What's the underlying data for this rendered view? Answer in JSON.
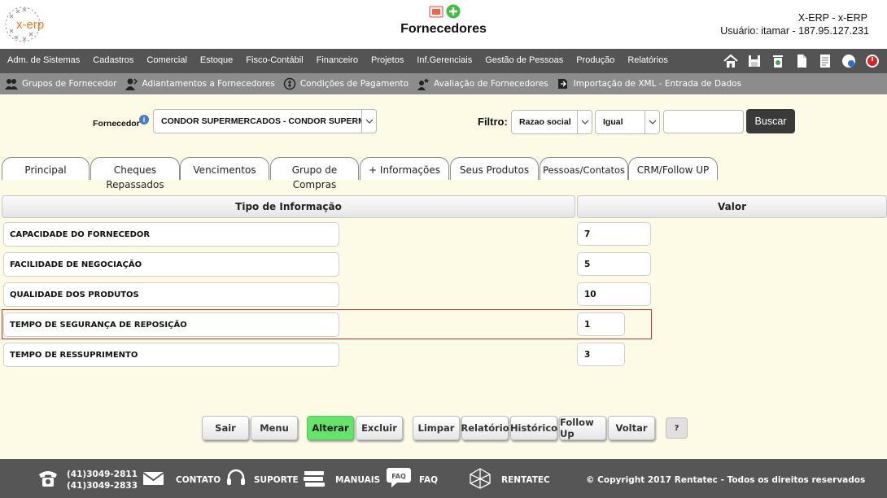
{
  "header": {
    "logo_text": "x-erp",
    "title": "Fornecedores",
    "user_line1": "X-ERP - x-ERP",
    "user_line2": "Usuário: itamar - 187.95.127.231"
  },
  "main_menu": [
    "Adm. de Sistemas",
    "Cadastros",
    "Comercial",
    "Estoque",
    "Fisco-Contábil",
    "Financeiro",
    "Projetos",
    "Inf.Gerenciais",
    "Gestão de Pessoas",
    "Produção",
    "Relatórios"
  ],
  "sub_menu": [
    {
      "label": "Grupos de Fornecedor",
      "icon": "group-icon"
    },
    {
      "label": "Adiantamentos a Fornecedores",
      "icon": "advance-icon"
    },
    {
      "label": "Condições de Pagamento",
      "icon": "payment-icon"
    },
    {
      "label": "Avaliação de Fornecedores",
      "icon": "evaluation-icon"
    },
    {
      "label": "Importação de XML - Entrada de Dados",
      "icon": "import-icon"
    }
  ],
  "filter": {
    "fornecedor_label": "Fornecedor",
    "fornecedor_value": "CONDOR SUPERMERCADOS - CONDOR SUPERMI",
    "filtro_label": "Filtro:",
    "filtro_field": "Razao social",
    "filtro_operator": "Igual",
    "search_value": "",
    "buscar_label": "Buscar"
  },
  "tabs": [
    {
      "line1": "Principal",
      "line2": ""
    },
    {
      "line1": "Cheques",
      "line2": "Repassados"
    },
    {
      "line1": "Vencimentos",
      "line2": ""
    },
    {
      "line1": "Grupo de",
      "line2": "Compras"
    },
    {
      "line1": "+ Informações",
      "line2": ""
    },
    {
      "line1": "Seus Produtos",
      "line2": ""
    },
    {
      "line1": "Pessoas/Contatos",
      "line2": ""
    },
    {
      "line1": "CRM/Follow UP",
      "line2": ""
    }
  ],
  "table": {
    "col_tipo": "Tipo de Informação",
    "col_valor": "Valor",
    "rows": [
      {
        "tipo": "CAPACIDADE DO FORNECEDOR",
        "valor": "7"
      },
      {
        "tipo": "FACILIDADE DE NEGOCIAÇÃO",
        "valor": "5"
      },
      {
        "tipo": "QUALIDADE DOS PRODUTOS",
        "valor": "10"
      },
      {
        "tipo": "TEMPO DE SEGURANÇA DE REPOSIÇÃO",
        "valor": "1"
      },
      {
        "tipo": "TEMPO DE RESSUPRIMENTO",
        "valor": "3"
      }
    ]
  },
  "actions": [
    "Sair",
    "Menu",
    "Alterar",
    "Excluir",
    "Limpar",
    "Relatório",
    "Histórico",
    "Follow Up",
    "Voltar",
    "?"
  ],
  "footer": {
    "phone1": "(41)3049-2811",
    "phone2": "(41)3049-2833",
    "contato": "CONTATO",
    "suporte": "SUPORTE",
    "manuais": "MANUAIS",
    "faq_badge": "FAQ",
    "faq": "FAQ",
    "rentatec": "RENTATEC",
    "copyright": "© Copyright 2017 Rentatec - Todos os direitos reservados"
  },
  "colors": {
    "background": "#fdfbe6",
    "menu_bar": "#545454",
    "sub_menu_bar": "#8c8c8c",
    "alterar_button": "#66e36b",
    "highlight_border": "#c23333"
  }
}
